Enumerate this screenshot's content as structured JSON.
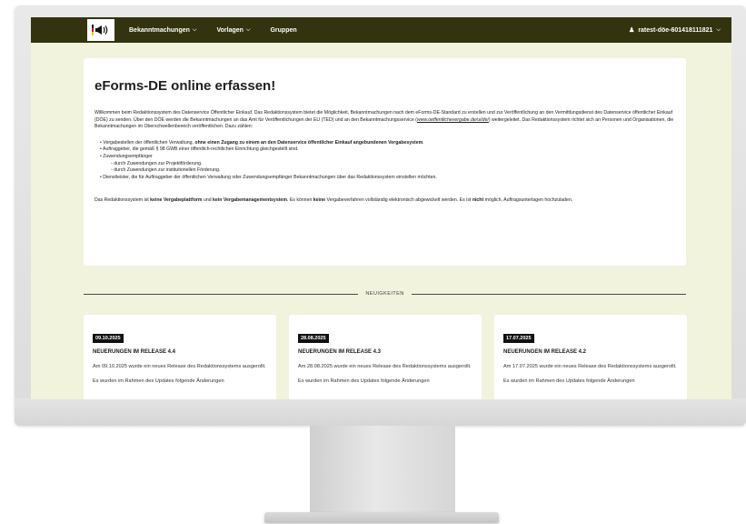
{
  "navbar": {
    "items": [
      {
        "label": "Bekanntmachungen",
        "has_caret": true
      },
      {
        "label": "Vorlagen",
        "has_caret": true
      },
      {
        "label": "Gruppen",
        "has_caret": false
      }
    ],
    "user_label": "ratest-döe-601418111821"
  },
  "intro": {
    "title": "eForms-DE online erfassen!",
    "paragraph_before_link": "Willkommen beim Redaktionssystem des Datenservice Öffentlicher Einkauf. Das Redaktionssystem bietet die Möglichkeit, Bekanntmachungen nach dem eForms-DE-Standard zu erstellen und zur Veröffentlichung an den Vermittlungsdienst des Datenservice öffentlicher Einkauf (DÖE) zu senden. Über den DÖE werden die Bekanntmachungen an das Amt für Veröffentlichungen der EU (TED) und an den Bekanntmachungsservice (",
    "link": "www.oeffentlichevergabe.de/ui/de/",
    "paragraph_after_link": ") weitergeleitet. Das Redaktionssystem richtet sich an Personen und Organisationen, die Bekanntmachungen im Oberschwellenbereich veröffentlichen. Dazu zählen:",
    "list": {
      "item1_prefix": "Vergabestellen der öffentlichen Verwaltung, ",
      "item1_bold": "ohne einen Zugang zu einem an den Datenservice öffentlicher Einkauf angebundenen Vergabesystem",
      "item1_suffix": ".",
      "item2": "Auftraggeber, die gemäß § 98 GWB einer öffentlich-rechtlichen Einrichtung gleichgestellt sind.",
      "item3": "Zuwendungsempfänger",
      "item3_sub1": "durch Zuwendungen zur Projektförderung.",
      "item3_sub2": "durch Zuwendungen zur institutionellen Förderung.",
      "item4": "Dienstleister, die für Auftraggeber der öffentlichen Verwaltung oder Zuwendungsempfänger Bekanntmachungen über das Redaktionssystem einstellen möchten."
    },
    "footer": {
      "t1": "Das Redaktionssystem ist ",
      "b1": "keine Vergabeplattform",
      "t2": " und ",
      "b2": "kein Vergabemanagementsystem",
      "t3": ". Es können ",
      "b3": "keine",
      "t4": " Vergabeverfahren vollständig elektronisch abgewickelt werden. Es ist ",
      "b4": "nicht",
      "t5": " möglich, Auftragsunterlagen hochzuladen."
    }
  },
  "news": {
    "heading": "NEUIGKEITEN",
    "cards": [
      {
        "date": "09.10.2025",
        "title": "NEUERUNGEN IM RELEASE 4.4",
        "text1": "Am 09.10.2025 wurde ein neues Release des Redaktionssystems ausgerollt.",
        "text2": "Es wurden im Rahmen des Updates folgende Änderungen"
      },
      {
        "date": "28.08.2025",
        "title": "NEUERUNGEN IM RELEASE 4.3",
        "text1": "Am 28.08.2025 wurde ein neues Release des Redaktionssystems ausgerollt.",
        "text2": "Es wurden im Rahmen des Updates folgende Änderungen"
      },
      {
        "date": "17.07.2025",
        "title": "NEUERUNGEN IM RELEASE 4.2",
        "text1": "Am 17.07.2025 wurde ein neues Release des Redaktionssystems ausgerollt.",
        "text2": "Es wurden im Rahmen des Updates folgende Änderungen"
      }
    ]
  },
  "colors": {
    "navbar_bg": "#33330f",
    "page_bg": "#f2f3dd",
    "date_badge_bg": "#111111"
  },
  "icons": {
    "logo": "megaphone-flag-logo",
    "user": "user-icon",
    "caret": "chevron-down-icon"
  }
}
